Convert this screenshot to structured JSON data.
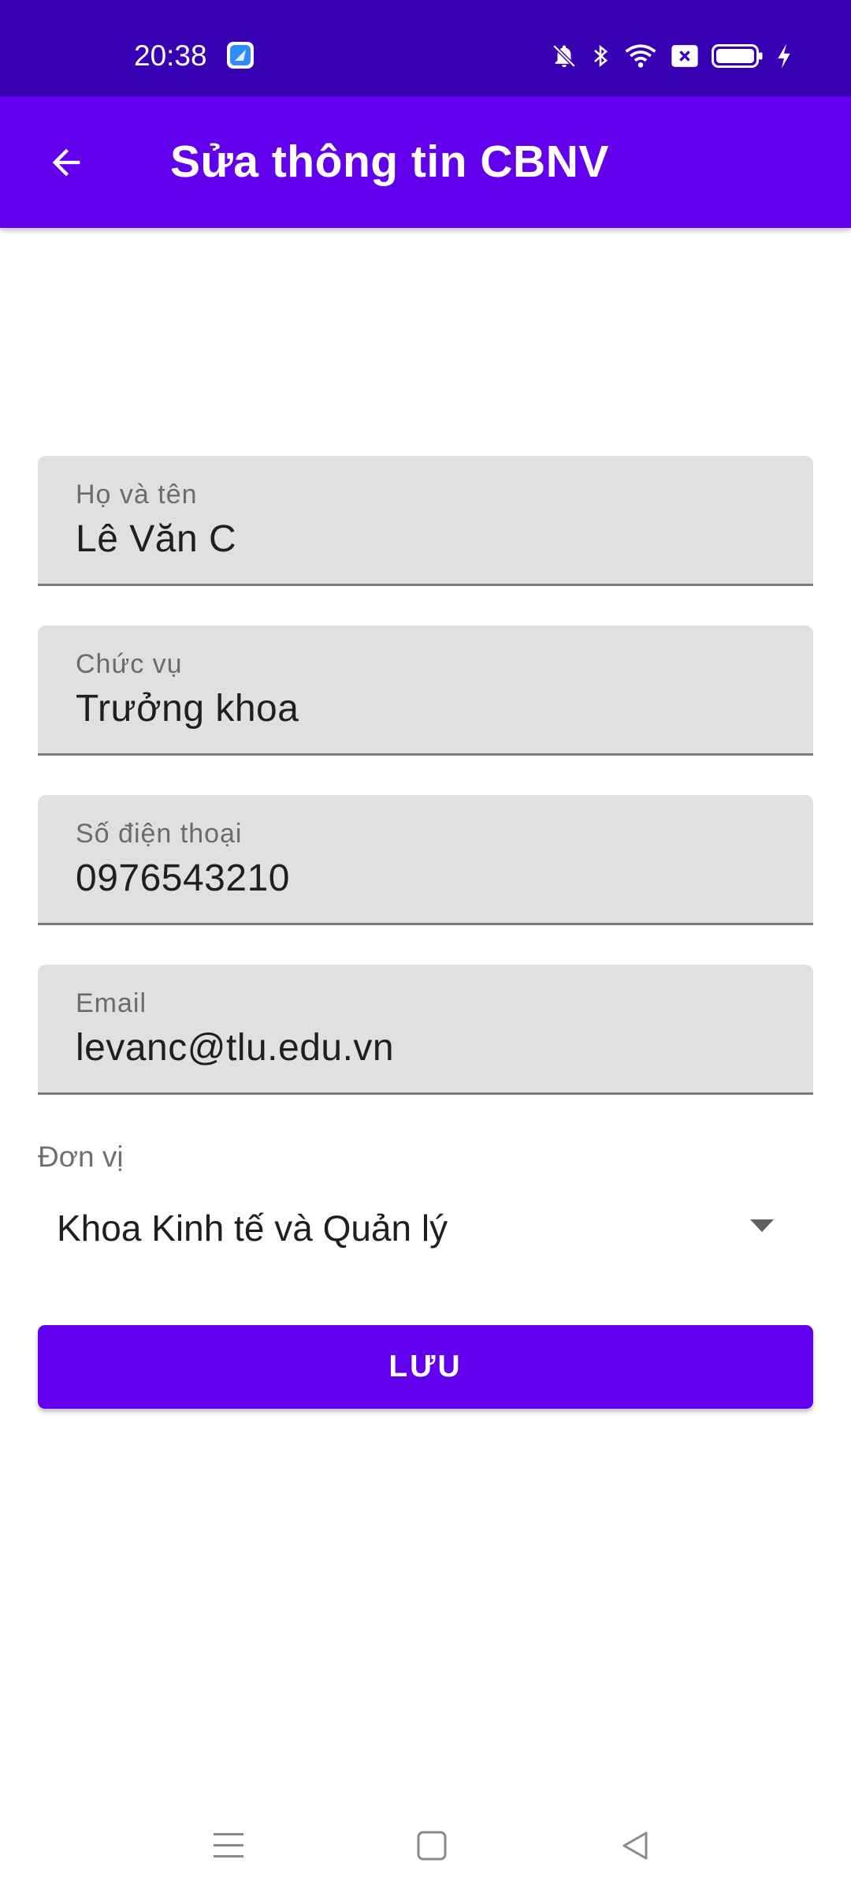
{
  "status_bar": {
    "time": "20:38",
    "icons": [
      "app-notification-icon",
      "bell-off-icon",
      "bluetooth-icon",
      "wifi-icon",
      "sim-off-icon",
      "battery-icon",
      "charging-bolt-icon"
    ]
  },
  "app_bar": {
    "back_icon": "arrow-left-icon",
    "title": "Sửa thông tin CBNV"
  },
  "form": {
    "fields": [
      {
        "label": "Họ và tên",
        "value": "Lê Văn C"
      },
      {
        "label": "Chức vụ",
        "value": "Trưởng khoa"
      },
      {
        "label": "Số điện thoại",
        "value": "0976543210"
      },
      {
        "label": "Email",
        "value": "levanc@tlu.edu.vn"
      }
    ],
    "unit": {
      "label": "Đơn vị",
      "selected": "Khoa Kinh tế và Quản lý"
    },
    "save_label": "LƯU"
  },
  "nav_bar": {
    "icons": [
      "menu-icon",
      "home-square-icon",
      "back-triangle-icon"
    ]
  },
  "colors": {
    "status_bar": "#3700B3",
    "primary": "#6200EE",
    "field_background": "#E0E0E0"
  }
}
